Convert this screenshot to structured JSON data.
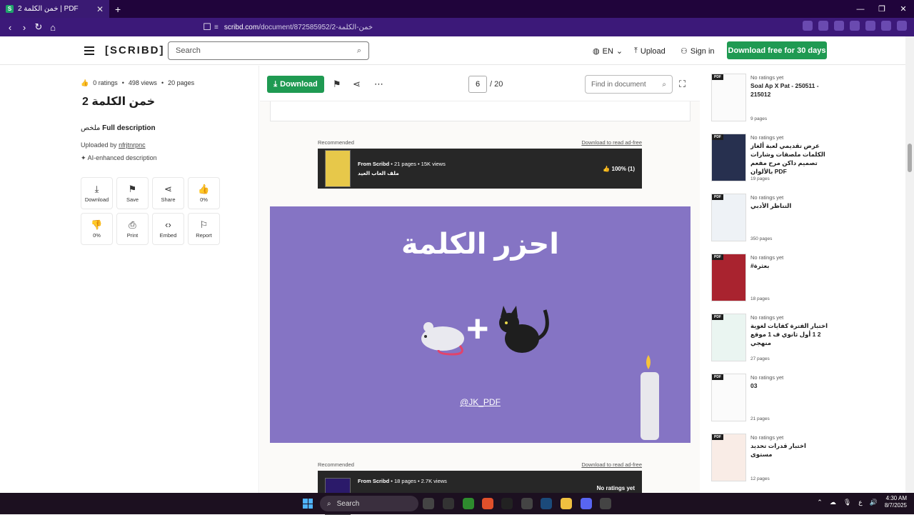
{
  "browser": {
    "tab_title": "2 خمن الكلمة | PDF",
    "tab_favicon": "S",
    "url_host": "scribd.com",
    "url_path": "/document/872585952/2-خمن-الكلمة",
    "new_tab": "+",
    "minimize": "—",
    "maximize": "❐",
    "close": "✕"
  },
  "header": {
    "logo": "[SCRIBD]",
    "search_placeholder": "Search",
    "lang": "EN",
    "upload": "Upload",
    "sign_in": "Sign in",
    "cta": "Download free for 30 days"
  },
  "document": {
    "ratings": "0 ratings",
    "views": "498 views",
    "pages": "20 pages",
    "title": "2 خمن الكلمة",
    "summary_label": "ملخص",
    "full_description": "Full description",
    "uploaded_by_label": "Uploaded by",
    "uploader": "nfrjtnrpnc",
    "ai_description": "AI-enhanced description"
  },
  "actions": [
    {
      "label": "Download",
      "icon": "⤓"
    },
    {
      "label": "Save",
      "icon": "⚑"
    },
    {
      "label": "Share",
      "icon": "⋖"
    },
    {
      "label": "0%",
      "icon": "👍"
    },
    {
      "label": "0%",
      "icon": "👎"
    },
    {
      "label": "Print",
      "icon": "⎙"
    },
    {
      "label": "Embed",
      "icon": "‹›"
    },
    {
      "label": "Report",
      "icon": "⚐"
    }
  ],
  "viewer": {
    "download": "Download",
    "current_page": "6",
    "total_pages": "/ 20",
    "find_placeholder": "Find in document",
    "recommended": "Recommended",
    "download_ad_free": "Download to read ad-free",
    "rec1_source": "From Scribd",
    "rec1_pages": "21 pages",
    "rec1_views": "15K views",
    "rec1_title": "ملف العاب العيد",
    "rec1_rating": "100% (1)",
    "rec2_source": "From Scribd",
    "rec2_pages": "18 pages",
    "rec2_views": "2.7K views",
    "rec2_rating": "No ratings yet",
    "slide_title": "احزر الكلمة",
    "slide_plus": "+",
    "slide_handle": "@JK_PDF"
  },
  "sidebar": [
    {
      "rating": "No ratings yet",
      "name": "Soal Ap X Pat - 250511 - 215012",
      "pages": "9 pages"
    },
    {
      "rating": "No ratings yet",
      "name": "عرض تقديمي لعبة ألغاز الكلمات ملصقات وشارات تصميم داكن مرح مفعم بالألوان PDF",
      "pages": "19 pages"
    },
    {
      "rating": "No ratings yet",
      "name": "التناظر الأدبي",
      "pages": "350 pages"
    },
    {
      "rating": "No ratings yet",
      "name": "#بعثرة",
      "pages": "18 pages"
    },
    {
      "rating": "No ratings yet",
      "name": "اختبار الفترة كفايات لغوية 2 1 أول ثانوي ف 1 موقع منهجي",
      "pages": "27 pages"
    },
    {
      "rating": "No ratings yet",
      "name": "03",
      "pages": "21 pages"
    },
    {
      "rating": "No ratings yet",
      "name": "اختبار قدرات تحديد مستوى",
      "pages": "12 pages"
    }
  ],
  "taskbar": {
    "search": "Search",
    "lang": "ع",
    "time": "4:30 AM",
    "date": "8/7/2025"
  }
}
